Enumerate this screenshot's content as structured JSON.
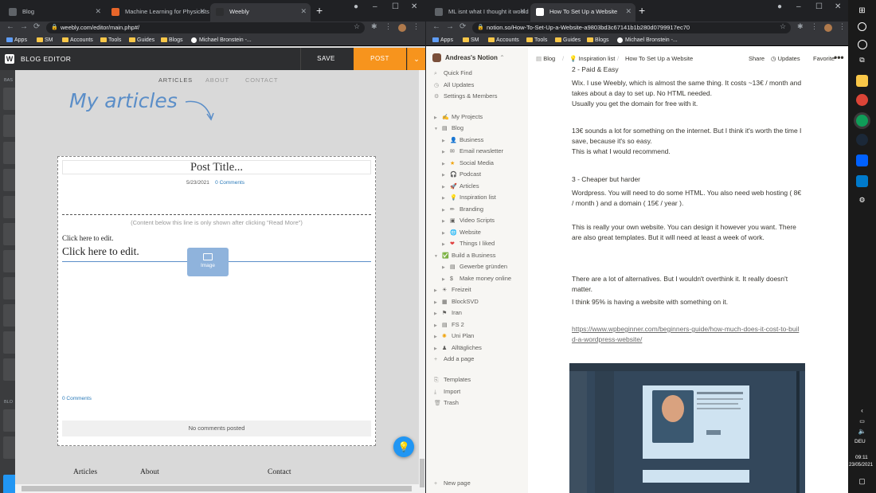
{
  "left_browser": {
    "tabs": [
      {
        "title": "Blog",
        "active": false
      },
      {
        "title": "Machine Learning for Physicists",
        "active": false
      },
      {
        "title": "Weebly",
        "active": true
      }
    ],
    "url": "weebly.com/editor/main.php#/",
    "bookmarks": [
      "Apps",
      "SM",
      "Accounts",
      "Tools",
      "Guides",
      "Blogs",
      "Michael Bronstein -..."
    ]
  },
  "weebly": {
    "brand": "BLOG EDITOR",
    "save": "SAVE",
    "post": "POST",
    "nav": [
      "ARTICLES",
      "ABOUT",
      "CONTACT"
    ],
    "heading": "My articles",
    "post_title": "Post Title...",
    "post_date": "5/23/2021",
    "comments_link": "0 Comments",
    "read_more_note": "(Content below this line is only shown after clicking \"Read More\")",
    "edit_small": "Click here to edit.",
    "edit_large": "Click here to edit.",
    "image_label": "Image",
    "bottom_comments": "0 Comments",
    "no_comments": "No comments posted",
    "footer": [
      "Articles",
      "About",
      "Contact"
    ],
    "side_labels": [
      "BAS",
      "BLO"
    ],
    "accent_color": "#f7941d"
  },
  "right_browser": {
    "tabs": [
      {
        "title": "ML isnt what I thought it would b",
        "active": false
      },
      {
        "title": "How To Set Up a Website",
        "active": true
      }
    ],
    "url": "notion.so/How-To-Set-Up-a-Website-a9803bd3c67141b1b280d0799917ec70",
    "bookmarks": [
      "Apps",
      "SM",
      "Accounts",
      "Tools",
      "Guides",
      "Blogs",
      "Michael Bronstein -..."
    ]
  },
  "notion": {
    "workspace": "Andreas's Notion",
    "top": [
      "Quick Find",
      "All Updates",
      "Settings & Members"
    ],
    "tree": [
      {
        "label": "My Projects",
        "depth": 0
      },
      {
        "label": "Blog",
        "depth": 0,
        "open": true
      },
      {
        "label": "Business",
        "depth": 1
      },
      {
        "label": "Email newsletter",
        "depth": 1
      },
      {
        "label": "Social Media",
        "depth": 1
      },
      {
        "label": "Podcast",
        "depth": 1
      },
      {
        "label": "Articles",
        "depth": 1
      },
      {
        "label": "Inspiration list",
        "depth": 1
      },
      {
        "label": "Branding",
        "depth": 1
      },
      {
        "label": "Video Scripts",
        "depth": 1
      },
      {
        "label": "Website",
        "depth": 1
      },
      {
        "label": "Things I liked",
        "depth": 1
      },
      {
        "label": "Build a Business",
        "depth": 0,
        "open": true
      },
      {
        "label": "Gewerbe gründen",
        "depth": 1
      },
      {
        "label": "Make money online",
        "depth": 1
      },
      {
        "label": "Freizeit",
        "depth": 0
      },
      {
        "label": "BlockSVD",
        "depth": 0
      },
      {
        "label": "Iran",
        "depth": 0
      },
      {
        "label": "FS 2",
        "depth": 0
      },
      {
        "label": "Uni Plan",
        "depth": 0
      },
      {
        "label": "Alltägliches",
        "depth": 0
      }
    ],
    "add_page": "Add a page",
    "bottom": [
      "Templates",
      "Import",
      "Trash"
    ],
    "new_page": "New page",
    "breadcrumb": [
      "Blog",
      "Inspiration list",
      "How To Set Up a Website"
    ],
    "actions": [
      "Share",
      "Updates",
      "Favorite"
    ],
    "content": {
      "p_heading_2": "2 - Paid & Easy",
      "p1": "Wix. I use Weebly, which is almost the same thing. It costs ~13€ / month and takes about a day to set up. No HTML needed.",
      "p2": "Usually you get the domain for free with it.",
      "p3": "13€ sounds a lot for something on the internet. But I think it's worth the time I save, because it's so easy.",
      "p4": "This is what I would recommend.",
      "p_heading_3": "3 - Cheaper but harder",
      "p5": "Wordpress. You will need to do some HTML. You also need web hosting ( 8€ / month ) and a domain ( 15€ / year ).",
      "p6": "This is really your own website. You can design it however you want. There are also great templates. But it will need at least a week of work.",
      "p7": "There are a lot of alternatives. But I wouldn't overthink it. It really doesn't matter.",
      "p8": "I think 95% is having a website with something on it.",
      "link": "https://www.wpbeginner.com/beginners-guide/how-much-does-it-cost-to-build-a-wordpress-website/"
    },
    "help": "?"
  },
  "taskbar": {
    "lang": "DEU",
    "time": "09:11",
    "date": "23/05/2021"
  }
}
